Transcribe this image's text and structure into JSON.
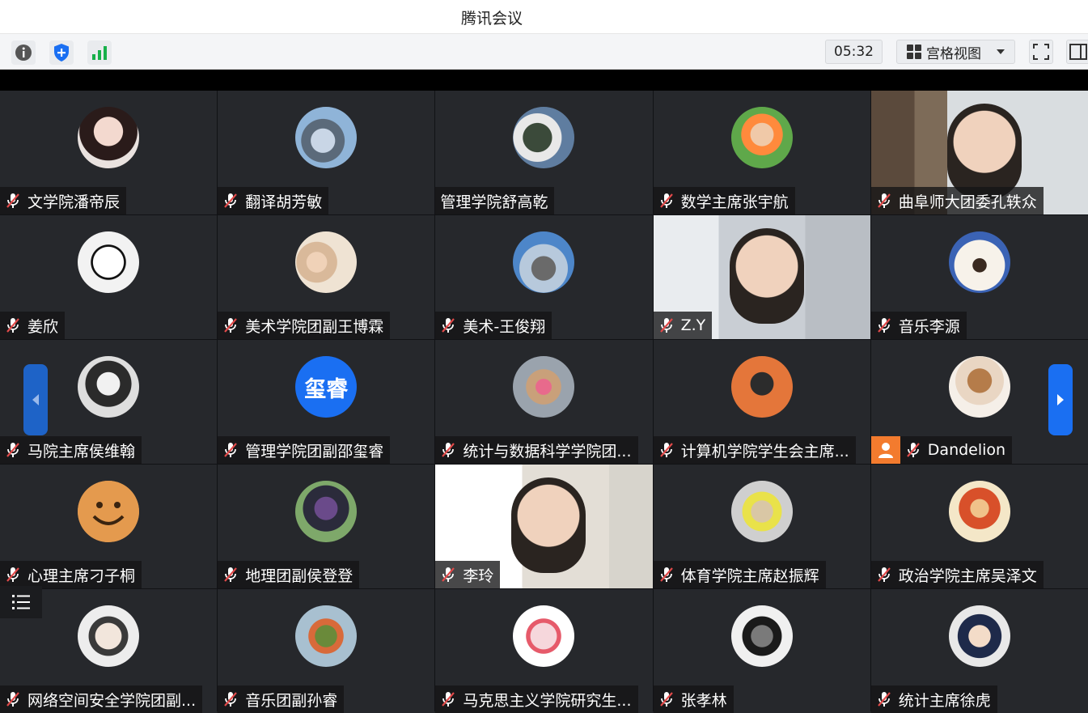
{
  "window": {
    "title": "腾讯会议"
  },
  "toolbar": {
    "timer": "05:32",
    "view_label": "宫格视图",
    "icons": [
      "info-icon",
      "shield-icon",
      "signal-icon",
      "fullscreen-icon",
      "side-panel-icon"
    ]
  },
  "colors": {
    "accent_blue": "#1a6ff2",
    "host_orange": "#f37b2e",
    "tile_bg": "#26282c"
  },
  "participants": [
    {
      "name": "文学院潘帝辰",
      "muted": true
    },
    {
      "name": "翻译胡芳敏",
      "muted": true
    },
    {
      "name": "管理学院舒高乾",
      "muted": false
    },
    {
      "name": "数学主席张宇航",
      "muted": true
    },
    {
      "name": "曲阜师大团委孔轶众",
      "muted": true
    },
    {
      "name": "姜欣",
      "muted": true
    },
    {
      "name": "美术学院团副王博霖",
      "muted": true
    },
    {
      "name": "美术-王俊翔",
      "muted": true
    },
    {
      "name": "Z.Y",
      "muted": true
    },
    {
      "name": "音乐李源",
      "muted": true
    },
    {
      "name": "马院主席侯维翰",
      "muted": true
    },
    {
      "name": "管理学院团副邵玺睿",
      "muted": true,
      "avatar_text": "玺睿"
    },
    {
      "name": "统计与数据科学学院团...",
      "muted": true
    },
    {
      "name": "计算机学院学生会主席...",
      "muted": true
    },
    {
      "name": "Dandelion",
      "muted": true,
      "host": true
    },
    {
      "name": "心理主席刁子桐",
      "muted": true
    },
    {
      "name": "地理团副侯登登",
      "muted": true
    },
    {
      "name": "李玲",
      "muted": true
    },
    {
      "name": "体育学院主席赵振辉",
      "muted": true
    },
    {
      "name": "政治学院主席吴泽文",
      "muted": true
    },
    {
      "name": "网络空间安全学院团副...",
      "muted": true
    },
    {
      "name": "音乐团副孙睿",
      "muted": true
    },
    {
      "name": "马克思主义学院研究生...",
      "muted": true
    },
    {
      "name": "张孝林",
      "muted": true
    },
    {
      "name": "统计主席徐虎",
      "muted": true
    }
  ]
}
